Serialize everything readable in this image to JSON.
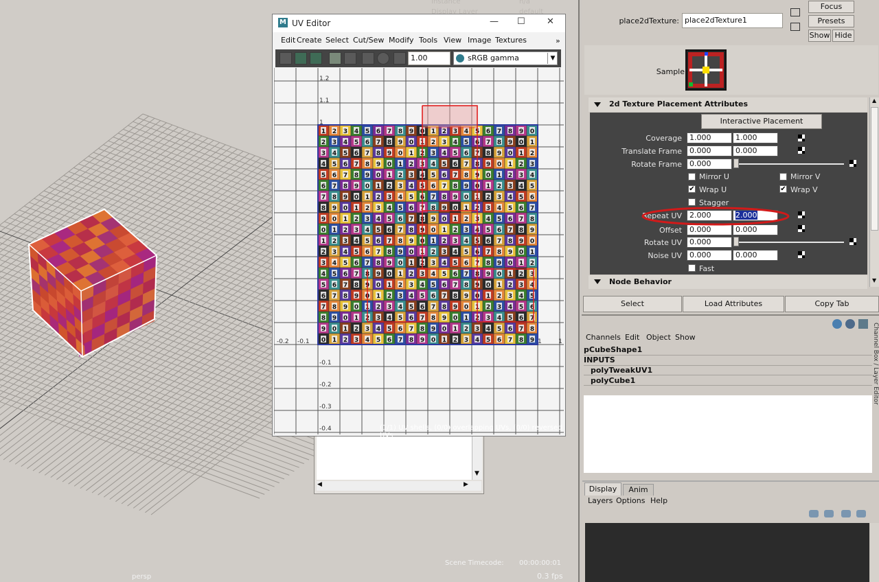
{
  "viewport": {
    "camera_label": "persp",
    "timecode_label": "Scene Timecode:",
    "timecode_value": "00:00:00:01",
    "fps": "0.3 fps",
    "hud_instance_label": "Instance",
    "hud_instance_value": "n/a",
    "hud_display_layer_label": "Display Layer",
    "hud_display_layer_value": "default"
  },
  "uv_editor": {
    "title": "UV Editor",
    "window_controls": {
      "minimize": "—",
      "maximize": "☐",
      "close": "✕"
    },
    "menu": [
      "Edit",
      "Create",
      "Select",
      "Cut/Sew",
      "Modify",
      "Tools",
      "View",
      "Image",
      "Textures"
    ],
    "menu_more": "»",
    "gamma_value": "1.00",
    "colorspace": "sRGB gamma",
    "v_ticks": [
      "1.2",
      "1.1",
      "1",
      "-0.1",
      "-0.2",
      "-0.3",
      "-0.4"
    ],
    "u_ticks": [
      "-0.2",
      "-0.1",
      "1",
      "1"
    ],
    "status": "(1/1) UV shells, (0/0) overlapping UVs, (0/0) reversed UVs",
    "texture_digits": [
      "1",
      "2",
      "3",
      "4",
      "5",
      "6",
      "7",
      "8",
      "9",
      "0"
    ]
  },
  "attribute_editor": {
    "node_label": "place2dTexture:",
    "node_value": "place2dTexture1",
    "focus": "Focus",
    "presets": "Presets",
    "show": "Show",
    "hide": "Hide",
    "sample_label": "Sample",
    "section_2d": "2d Texture Placement Attributes",
    "interactive_placement": "Interactive Placement",
    "coverage_label": "Coverage",
    "coverage_u": "1.000",
    "coverage_v": "1.000",
    "translate_frame_label": "Translate Frame",
    "translate_frame_u": "0.000",
    "translate_frame_v": "0.000",
    "rotate_frame_label": "Rotate Frame",
    "rotate_frame_value": "0.000",
    "mirror_u": "Mirror U",
    "mirror_v": "Mirror V",
    "wrap_u": "Wrap U",
    "wrap_v": "Wrap V",
    "stagger": "Stagger",
    "repeat_uv_label": "Repeat UV",
    "repeat_u": "2.000",
    "repeat_v": "2.000",
    "offset_label": "Offset",
    "offset_u": "0.000",
    "offset_v": "0.000",
    "rotate_uv_label": "Rotate UV",
    "rotate_uv_value": "0.000",
    "noise_uv_label": "Noise UV",
    "noise_u": "0.000",
    "noise_v": "0.000",
    "fast": "Fast",
    "section_node_behavior": "Node Behavior",
    "select_button": "Select",
    "load_attributes_button": "Load Attributes",
    "copy_tab_button": "Copy Tab"
  },
  "channel_box": {
    "menu": [
      "Channels",
      "Edit",
      "Object",
      "Show"
    ],
    "rows": [
      "pCubeShape1",
      "INPUTS",
      "polyTweakUV1",
      "polyCube1"
    ],
    "side_tab": "Channel Box / Layer Editor"
  },
  "layer_editor": {
    "tabs": [
      "Display",
      "Anim"
    ],
    "menu": [
      "Layers",
      "Options",
      "Help"
    ]
  }
}
